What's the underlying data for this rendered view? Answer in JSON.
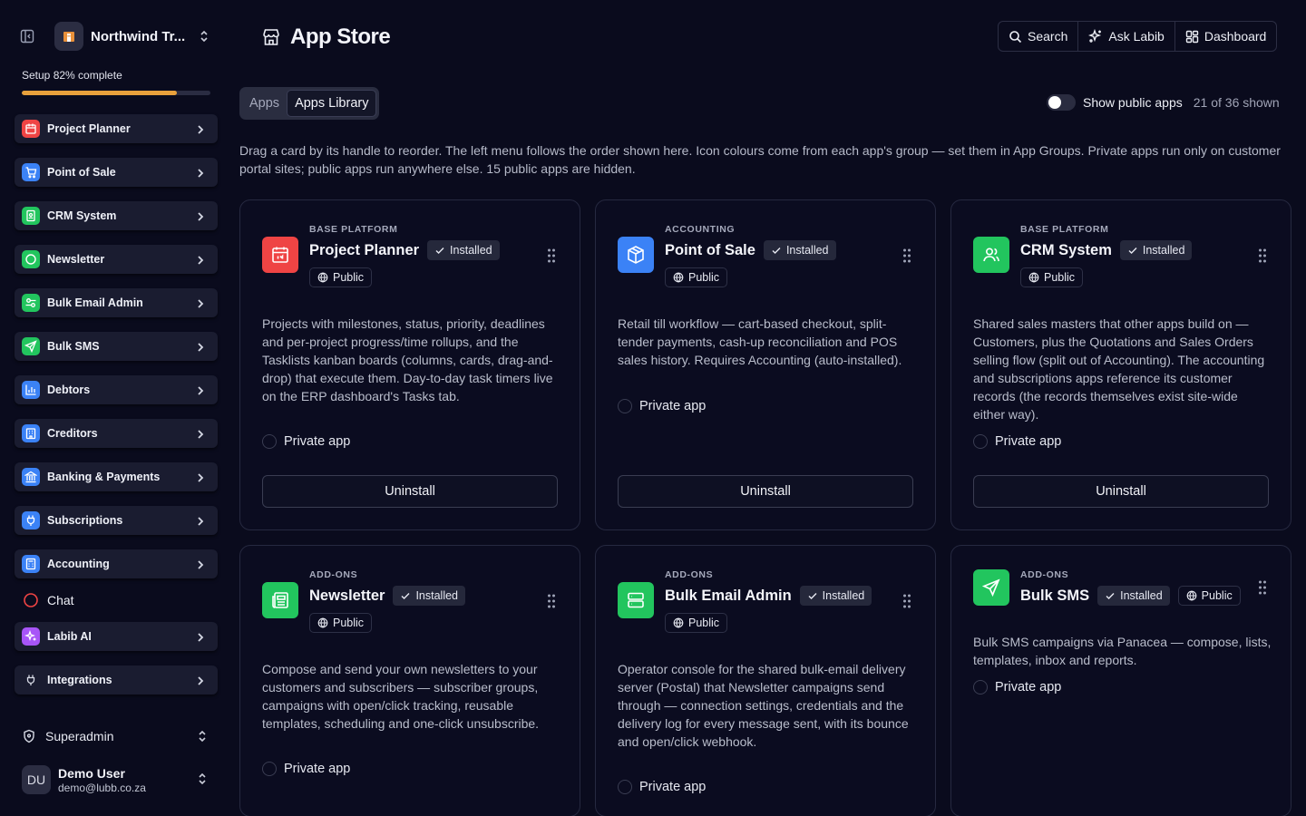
{
  "colors": {
    "accent": "#e8a13c",
    "installed_green": "#22c55e",
    "red": "#ef4444",
    "blue": "#3b82f6",
    "purple": "#a855f7"
  },
  "sidebar": {
    "org_name": "Northwind Tr...",
    "setup_label": "Setup 82% complete",
    "setup_progress": 0.82,
    "items": [
      {
        "label": "Project Planner",
        "icon": "calendar-icon",
        "color": "#ef4444"
      },
      {
        "label": "Point of Sale",
        "icon": "cart-icon",
        "color": "#3b82f6"
      },
      {
        "label": "CRM System",
        "icon": "contact-icon",
        "color": "#22c55e"
      },
      {
        "label": "Newsletter",
        "icon": "circle-icon",
        "color": "#22c55e"
      },
      {
        "label": "Bulk Email Admin",
        "icon": "sliders-icon",
        "color": "#22c55e"
      },
      {
        "label": "Bulk SMS",
        "icon": "send-icon",
        "color": "#22c55e"
      },
      {
        "label": "Debtors",
        "icon": "bar-chart-icon",
        "color": "#3b82f6"
      },
      {
        "label": "Creditors",
        "icon": "building-icon",
        "color": "#3b82f6"
      },
      {
        "label": "Banking & Payments",
        "icon": "bank-icon",
        "color": "#3b82f6"
      },
      {
        "label": "Subscriptions",
        "icon": "plug-icon",
        "color": "#3b82f6"
      },
      {
        "label": "Accounting",
        "icon": "calculator-icon",
        "color": "#3b82f6"
      },
      {
        "label": "Chat",
        "icon": "chat-icon",
        "color": "#ef4444"
      },
      {
        "label": "Labib AI",
        "icon": "sparkle-icon",
        "color": "#a855f7"
      },
      {
        "label": "Integrations",
        "icon": "plug-icon",
        "color": ""
      }
    ],
    "role": "Superadmin",
    "user": {
      "initials": "DU",
      "name": "Demo User",
      "email": "demo@lubb.co.za"
    }
  },
  "header": {
    "title": "App Store",
    "actions": {
      "search": "Search",
      "ask": "Ask Labib",
      "dashboard": "Dashboard"
    }
  },
  "tabs": {
    "apps": "Apps",
    "library": "Apps Library"
  },
  "toggle": {
    "label": "Show public apps",
    "count": "21 of 36 shown",
    "on": false
  },
  "intro": "Drag a card by its handle to reorder. The left menu follows the order shown here. Icon colours come from each app's group — set them in App Groups. Private apps run only on customer portal sites; public apps run anywhere else. 15 public apps are hidden.",
  "cards": [
    {
      "group": "BASE PLATFORM",
      "title": "Project Planner",
      "installed": "Installed",
      "public": "Public",
      "icon": "calendar-icon",
      "color": "#ef4444",
      "description": "Projects with milestones, status, priority, deadlines and per-project progress/time rollups, and the Tasklists kanban boards (columns, cards, drag-and-drop) that execute them. Day-to-day task timers live on the ERP dashboard's Tasks tab.",
      "private": "Private app",
      "action": "Uninstall"
    },
    {
      "group": "ACCOUNTING",
      "title": "Point of Sale",
      "installed": "Installed",
      "public": "Public",
      "icon": "box-icon",
      "color": "#3b82f6",
      "description": "Retail till workflow — cart-based checkout, split-tender payments, cash-up reconciliation and POS sales history. Requires Accounting (auto-installed).",
      "private": "Private app",
      "action": "Uninstall"
    },
    {
      "group": "BASE PLATFORM",
      "title": "CRM System",
      "installed": "Installed",
      "public": "Public",
      "icon": "users-icon",
      "color": "#22c55e",
      "description": "Shared sales masters that other apps build on — Customers, plus the Quotations and Sales Orders selling flow (split out of Accounting). The accounting and subscriptions apps reference its customer records (the records themselves exist site-wide either way).",
      "private": "Private app",
      "action": "Uninstall"
    },
    {
      "group": "ADD-ONS",
      "title": "Newsletter",
      "installed": "Installed",
      "public": "Public",
      "icon": "newspaper-icon",
      "color": "#22c55e",
      "description": "Compose and send your own newsletters to your customers and subscribers — subscriber groups, campaigns with open/click tracking, reusable templates, scheduling and one-click unsubscribe.",
      "private": "Private app"
    },
    {
      "group": "ADD-ONS",
      "title": "Bulk Email Admin",
      "installed": "Installed",
      "public": "Public",
      "icon": "server-icon",
      "color": "#22c55e",
      "description": "Operator console for the shared bulk-email delivery server (Postal) that Newsletter campaigns send through — connection settings, credentials and the delivery log for every message sent, with its bounce and open/click webhook.",
      "private": "Private app"
    },
    {
      "group": "ADD-ONS",
      "title": "Bulk SMS",
      "installed": "Installed",
      "public": "Public",
      "icon": "send-icon",
      "color": "#22c55e",
      "description": "Bulk SMS campaigns via Panacea — compose, lists, templates, inbox and reports.",
      "private": "Private app"
    }
  ]
}
